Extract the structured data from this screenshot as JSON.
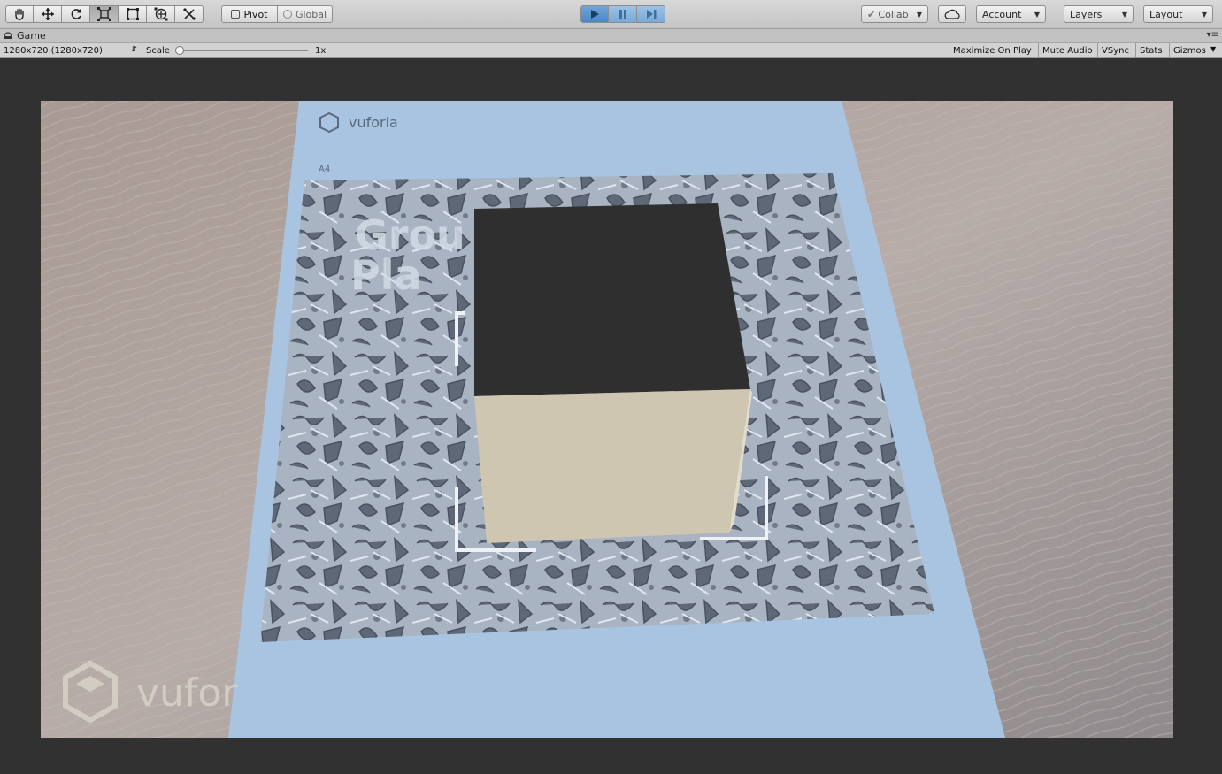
{
  "toolbar": {
    "tools": [
      {
        "name": "hand-tool",
        "icon": "hand-icon"
      },
      {
        "name": "move-tool",
        "icon": "move-icon"
      },
      {
        "name": "rotate-tool",
        "icon": "rotate-icon"
      },
      {
        "name": "scale-tool",
        "icon": "scale-icon",
        "active": true
      },
      {
        "name": "rect-tool",
        "icon": "rect-icon"
      },
      {
        "name": "transform-tool",
        "icon": "transform-icon"
      },
      {
        "name": "custom-tool",
        "icon": "custom-tool-icon"
      }
    ],
    "pivot_label": "Pivot",
    "global_label": "Global",
    "collab_label": "Collab",
    "account_label": "Account",
    "layers_label": "Layers",
    "layout_label": "Layout"
  },
  "game_tab": {
    "title": "Game"
  },
  "game_toolbar": {
    "resolution": "1280x720 (1280x720)",
    "scale_label": "Scale",
    "scale_value": "1x",
    "maximize_label": "Maximize On Play",
    "mute_label": "Mute Audio",
    "vsync_label": "VSync",
    "stats_label": "Stats",
    "gizmos_label": "Gizmos"
  },
  "viewport": {
    "target_brand": "vuforia",
    "paper_size": "A4",
    "target_title_line1": "Grou",
    "target_title_line2": "Pla",
    "watermark_brand": "vufor",
    "colors": {
      "cube_top": "#2f2f2f",
      "cube_front": "#cfc6b2",
      "cube_side": "#e3dccb"
    }
  }
}
